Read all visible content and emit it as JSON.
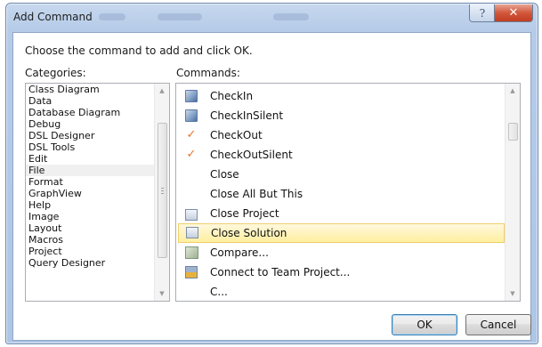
{
  "window": {
    "title": "Add Command",
    "help_glyph": "?",
    "close_glyph": "✕"
  },
  "instruction": "Choose the command to add and click OK.",
  "categories": {
    "label": "Categories:",
    "selected": "File",
    "items": [
      "Class Diagram",
      "Data",
      "Database Diagram",
      "Debug",
      "DSL Designer",
      "DSL Tools",
      "Edit",
      "File",
      "Format",
      "GraphView",
      "Help",
      "Image",
      "Layout",
      "Macros",
      "Project",
      "Query Designer"
    ]
  },
  "commands": {
    "label": "Commands:",
    "selected": "Close Solution",
    "items": [
      {
        "label": "CheckIn",
        "icon": "checkin-icon"
      },
      {
        "label": "CheckInSilent",
        "icon": "checkin-icon"
      },
      {
        "label": "CheckOut",
        "icon": "checkmark-icon"
      },
      {
        "label": "CheckOutSilent",
        "icon": "checkmark-icon"
      },
      {
        "label": "Close",
        "icon": ""
      },
      {
        "label": "Close All But This",
        "icon": ""
      },
      {
        "label": "Close Project",
        "icon": "solution-icon"
      },
      {
        "label": "Close Solution",
        "icon": "solution-icon"
      },
      {
        "label": "Compare...",
        "icon": "compare-icon"
      },
      {
        "label": "Connect to Team Project...",
        "icon": "team-project-icon"
      },
      {
        "label": "C...",
        "icon": ""
      }
    ]
  },
  "buttons": {
    "ok": "OK",
    "cancel": "Cancel"
  },
  "colors": {
    "selection_bg": "#feef9f",
    "checkmark": "#e8742a",
    "title_bar": "#b5cbe8",
    "close_button": "#d2573b"
  }
}
